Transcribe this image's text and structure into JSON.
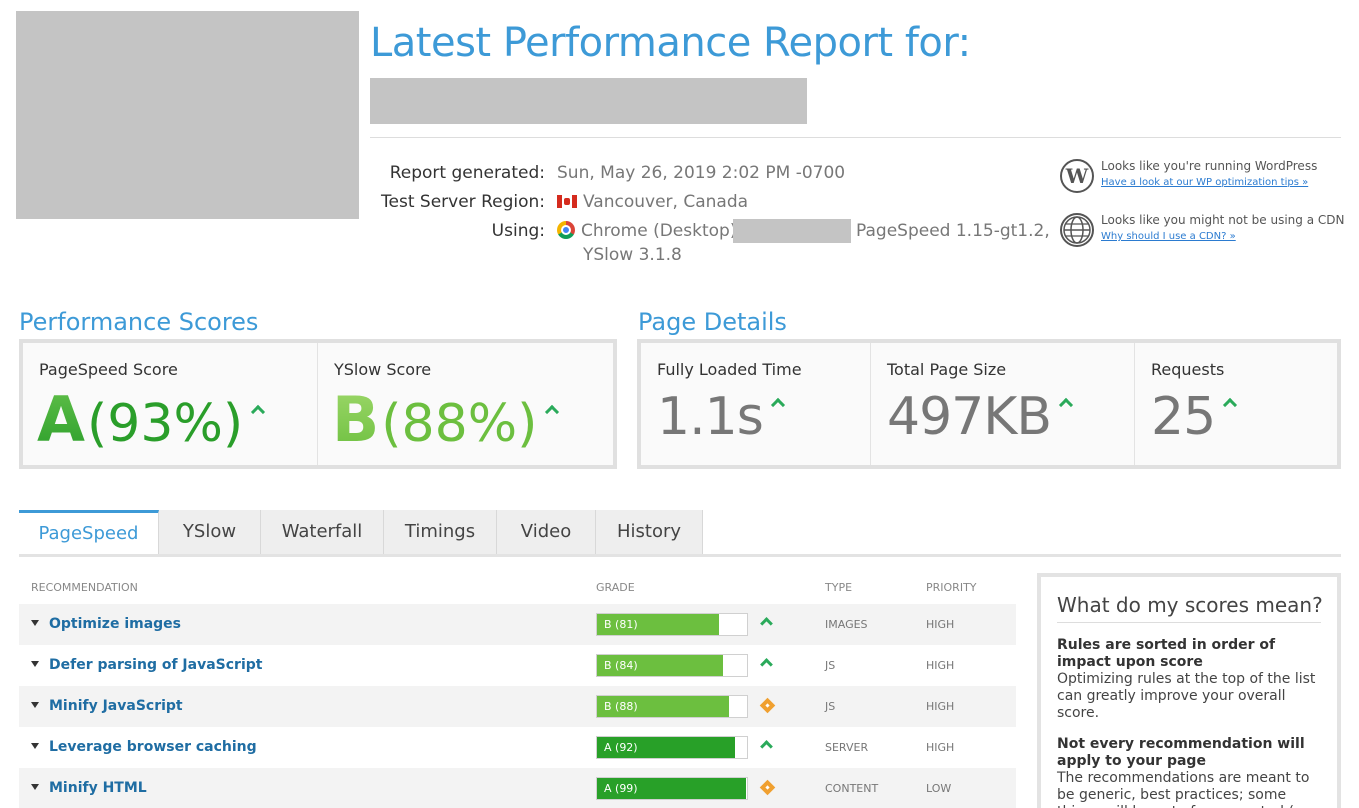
{
  "header": {
    "title": "Latest Performance Report for:"
  },
  "report": {
    "generated_label": "Report generated:",
    "generated_value": "Sun, May 26, 2019 2:02 PM -0700",
    "region_label": "Test Server Region:",
    "region_value": "Vancouver, Canada",
    "using_label": "Using:",
    "using_browser": "Chrome (Desktop)",
    "using_versions": "PageSpeed 1.15-gt1.2,",
    "using_versions_2": "YSlow 3.1.8"
  },
  "notices": [
    {
      "icon": "wordpress-icon",
      "text": "Looks like you're running WordPress",
      "link": "Have a look at our WP optimization tips »"
    },
    {
      "icon": "globe-icon",
      "text": "Looks like you might not be using a CDN",
      "link": "Why should I use a CDN? »"
    }
  ],
  "performance": {
    "title": "Performance Scores",
    "pagespeed_label": "PageSpeed Score",
    "pagespeed_grade": "A",
    "pagespeed_pct": "(93%)",
    "yslow_label": "YSlow Score",
    "yslow_grade": "B",
    "yslow_pct": "(88%)"
  },
  "details": {
    "title": "Page Details",
    "load_label": "Fully Loaded Time",
    "load_value": "1.1s",
    "size_label": "Total Page Size",
    "size_value": "497KB",
    "req_label": "Requests",
    "req_value": "25"
  },
  "tabs": [
    {
      "label": "PageSpeed",
      "active": true
    },
    {
      "label": "YSlow"
    },
    {
      "label": "Waterfall"
    },
    {
      "label": "Timings"
    },
    {
      "label": "Video"
    },
    {
      "label": "History"
    }
  ],
  "table": {
    "headers": {
      "recommendation": "RECOMMENDATION",
      "grade": "GRADE",
      "type": "TYPE",
      "priority": "PRIORITY"
    },
    "rows": [
      {
        "name": "Optimize images",
        "grade": "B (81)",
        "score": 81,
        "type": "IMAGES",
        "priority": "HIGH",
        "trend": "up",
        "color": "#6cbf3f"
      },
      {
        "name": "Defer parsing of JavaScript",
        "grade": "B (84)",
        "score": 84,
        "type": "JS",
        "priority": "HIGH",
        "trend": "up",
        "color": "#6cbf3f"
      },
      {
        "name": "Minify JavaScript",
        "grade": "B (88)",
        "score": 88,
        "type": "JS",
        "priority": "HIGH",
        "trend": "diamond",
        "color": "#6cbf3f"
      },
      {
        "name": "Leverage browser caching",
        "grade": "A (92)",
        "score": 92,
        "type": "SERVER",
        "priority": "HIGH",
        "trend": "up",
        "color": "#28a028"
      },
      {
        "name": "Minify HTML",
        "grade": "A (99)",
        "score": 99,
        "type": "CONTENT",
        "priority": "LOW",
        "trend": "diamond",
        "color": "#28a028"
      }
    ]
  },
  "sidebar": {
    "title": "What do my scores mean?",
    "h1": "Rules are sorted in order of impact upon score",
    "p1": "Optimizing rules at the top of the list can greatly improve your overall score.",
    "h2": "Not every recommendation will apply to your page",
    "p2": "The recommendations are meant to be generic, best practices; some things will be out of your control (eg. external"
  }
}
